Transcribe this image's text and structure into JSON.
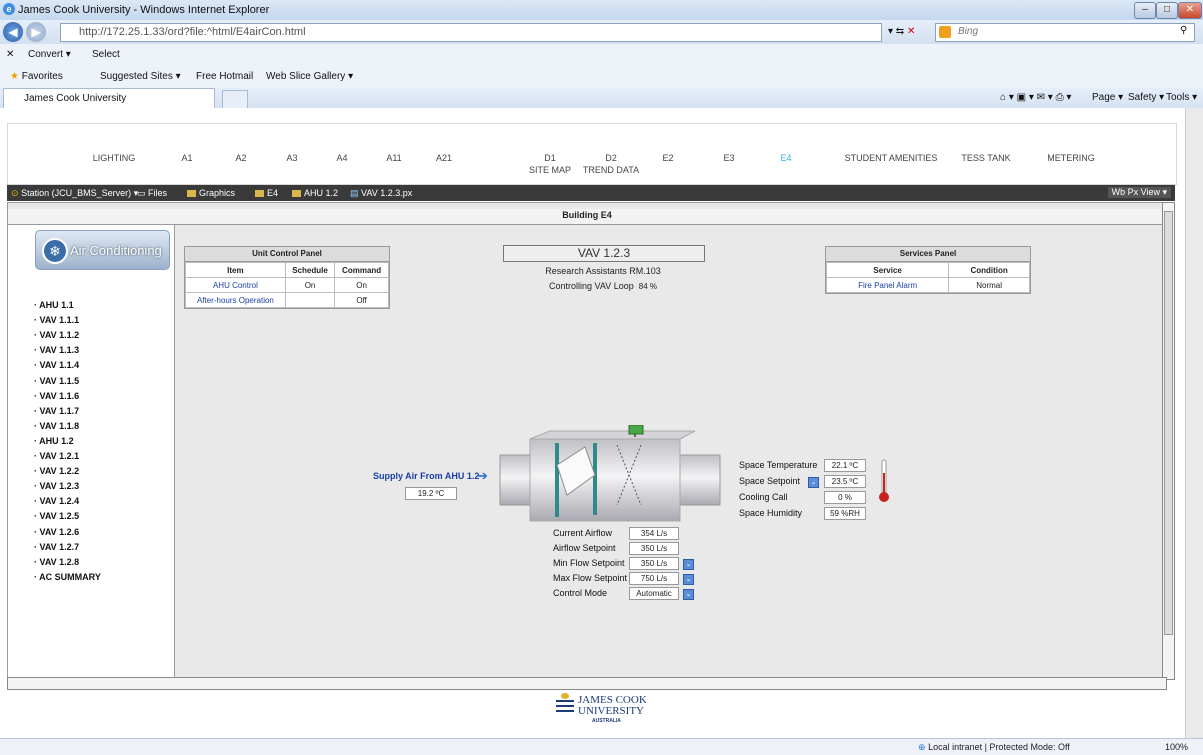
{
  "browser": {
    "window_title": "James Cook University - Windows Internet Explorer",
    "url": "http://172.25.1.33/ord?file:^html/E4airCon.html",
    "search_placeholder": "Bing",
    "cmd_convert": "Convert",
    "cmd_select": "Select",
    "favorites": "Favorites",
    "fav_items": [
      "Suggested Sites ▾",
      "Free Hotmail",
      "Web Slice Gallery ▾"
    ],
    "tab_title": "James Cook University",
    "tools": [
      "Page ▾",
      "Safety ▾",
      "Tools ▾"
    ],
    "status_zone": "Local intranet | Protected Mode: Off",
    "zoom": "100%"
  },
  "topnav": [
    {
      "label": "LIGHTING",
      "sub": "",
      "active": false
    },
    {
      "label": "A1",
      "sub": "",
      "active": false
    },
    {
      "label": "A2",
      "sub": "",
      "active": false
    },
    {
      "label": "A3",
      "sub": "",
      "active": false
    },
    {
      "label": "A4",
      "sub": "",
      "active": false
    },
    {
      "label": "A11",
      "sub": "",
      "active": false
    },
    {
      "label": "A21",
      "sub": "",
      "active": false
    },
    {
      "label": "D1",
      "sub": "SITE MAP",
      "active": false
    },
    {
      "label": "D2",
      "sub": "TREND DATA",
      "active": false
    },
    {
      "label": "E2",
      "sub": "",
      "active": false
    },
    {
      "label": "E3",
      "sub": "",
      "active": false
    },
    {
      "label": "E4",
      "sub": "",
      "active": true
    },
    {
      "label": "STUDENT AMENITIES",
      "sub": "",
      "active": false
    },
    {
      "label": "TESS TANK",
      "sub": "",
      "active": false
    },
    {
      "label": "METERING",
      "sub": "",
      "active": false
    }
  ],
  "path": {
    "station": "Station (JCU_BMS_Server)",
    "files": "Files",
    "graphics": "Graphics",
    "e4": "E4",
    "ahu": "AHU 1.2",
    "vav": "VAV 1.2.3.px",
    "view": "Wb Px View"
  },
  "building_title": "Building E4",
  "sidebar": {
    "logo_label": "Air Conditioning",
    "items": [
      "AHU 1.1",
      "VAV 1.1.1",
      "VAV 1.1.2",
      "VAV 1.1.3",
      "VAV 1.1.4",
      "VAV 1.1.5",
      "VAV 1.1.6",
      "VAV 1.1.7",
      "VAV 1.1.8",
      "AHU 1.2",
      "VAV 1.2.1",
      "VAV 1.2.2",
      "VAV 1.2.3",
      "VAV 1.2.4",
      "VAV 1.2.5",
      "VAV 1.2.6",
      "VAV 1.2.7",
      "VAV 1.2.8",
      "AC SUMMARY"
    ]
  },
  "unit_panel": {
    "title": "Unit Control Panel",
    "headers": [
      "Item",
      "Schedule",
      "Command"
    ],
    "rows": [
      [
        "AHU Control",
        "On",
        "On"
      ],
      [
        "After-hours Operation",
        "",
        "Off"
      ]
    ]
  },
  "vav": {
    "title": "VAV 1.2.3",
    "room": "Research Assistants RM.103",
    "loop_label": "Controlling VAV Loop",
    "loop_value": "84 %"
  },
  "services_panel": {
    "title": "Services Panel",
    "headers": [
      "Service",
      "Condition"
    ],
    "rows": [
      [
        "Fire Panel Alarm",
        "Normal"
      ]
    ]
  },
  "supply": {
    "label": "Supply Air From AHU 1.2",
    "value": "19.2 ºC"
  },
  "space": [
    {
      "label": "Space Temperature",
      "value": "22.1 ºC"
    },
    {
      "label": "Space Setpoint",
      "value": "23.5 ºC"
    },
    {
      "label": "Cooling Call",
      "value": "0 %"
    },
    {
      "label": "Space Humidity",
      "value": "59 %RH"
    }
  ],
  "flow": [
    {
      "label": "Current Airflow",
      "value": "354 L/s"
    },
    {
      "label": "Airflow Setpoint",
      "value": "350 L/s"
    },
    {
      "label": "Min Flow Setpoint",
      "value": "350 L/s"
    },
    {
      "label": "Max Flow Setpoint",
      "value": "750 L/s"
    },
    {
      "label": "Control Mode",
      "value": "Automatic"
    }
  ],
  "footer": {
    "logo_line1": "JAMES COOK",
    "logo_line2": "UNIVERSITY",
    "logo_line3": "AUSTRALIA"
  },
  "colors": {
    "accent": "#3bb0e6",
    "link": "#1a3fa8",
    "dark_bar": "#3a3a3a"
  }
}
